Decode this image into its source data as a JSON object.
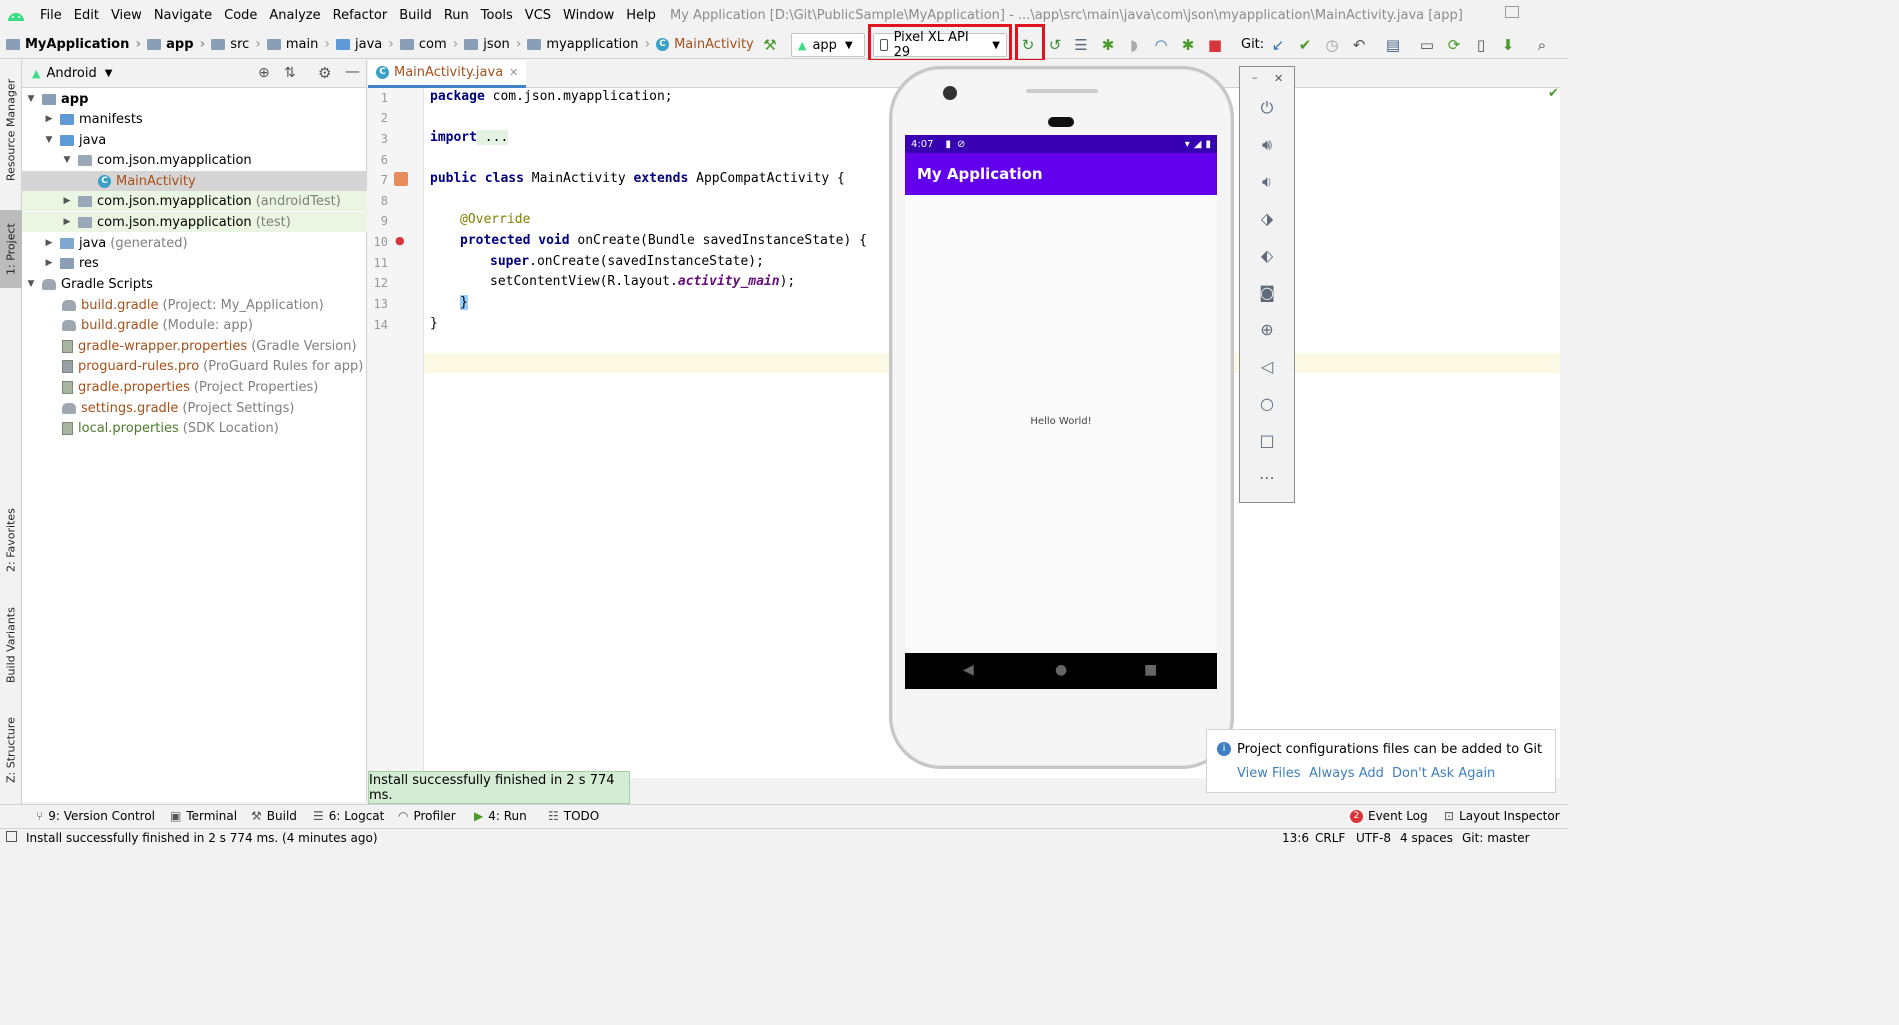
{
  "menu": {
    "items": [
      "File",
      "Edit",
      "View",
      "Navigate",
      "Code",
      "Analyze",
      "Refactor",
      "Build",
      "Run",
      "Tools",
      "VCS",
      "Window",
      "Help"
    ],
    "window_title": "My Application [D:\\Git\\PublicSample\\MyApplication] - ...\\app\\src\\main\\java\\com\\json\\myapplication\\MainActivity.java [app]"
  },
  "breadcrumb": {
    "items": [
      "MyApplication",
      "app",
      "src",
      "main",
      "java",
      "com",
      "json",
      "myapplication",
      "MainActivity"
    ]
  },
  "toolbar": {
    "run_config": "app",
    "device": "Pixel XL API 29",
    "git_label": "Git:"
  },
  "project": {
    "view_mode": "Android",
    "tree": [
      {
        "label": "app",
        "note": ""
      },
      {
        "label": "manifests",
        "note": ""
      },
      {
        "label": "java",
        "note": ""
      },
      {
        "label": "com.json.myapplication",
        "note": ""
      },
      {
        "label": "MainActivity",
        "note": ""
      },
      {
        "label": "com.json.myapplication",
        "note": "(androidTest)"
      },
      {
        "label": "com.json.myapplication",
        "note": "(test)"
      },
      {
        "label": "java",
        "note": "(generated)"
      },
      {
        "label": "res",
        "note": ""
      },
      {
        "label": "Gradle Scripts",
        "note": ""
      },
      {
        "label": "build.gradle",
        "note": "(Project: My_Application)"
      },
      {
        "label": "build.gradle",
        "note": "(Module: app)"
      },
      {
        "label": "gradle-wrapper.properties",
        "note": "(Gradle Version)"
      },
      {
        "label": "proguard-rules.pro",
        "note": "(ProGuard Rules for app)"
      },
      {
        "label": "gradle.properties",
        "note": "(Project Properties)"
      },
      {
        "label": "settings.gradle",
        "note": "(Project Settings)"
      },
      {
        "label": "local.properties",
        "note": "(SDK Location)"
      }
    ]
  },
  "side_tabs": {
    "resource_manager": "Resource Manager",
    "project": "1: Project",
    "favorites": "2: Favorites",
    "build_variants": "Build Variants",
    "structure": "Z: Structure"
  },
  "editor": {
    "tab": "MainActivity.java",
    "line_numbers": [
      "1",
      "2",
      "3",
      "6",
      "7",
      "8",
      "9",
      "10",
      "11",
      "12",
      "13",
      "14"
    ],
    "code": {
      "l1_kw": "package",
      "l1_rest": " com.json.myapplication;",
      "l3_kw": "import",
      "l3_rest": " ...",
      "l7_kw1": "public class",
      "l7_mid": " MainActivity ",
      "l7_kw2": "extends",
      "l7_rest": " AppCompatActivity {",
      "l9": "@Override",
      "l10_kw": "protected void",
      "l10_rest": " onCreate(Bundle savedInstanceState) {",
      "l11_kw": "super",
      "l11_rest": ".onCreate(savedInstanceState);",
      "l12_a": "setContentView(R.layout.",
      "l12_b": "activity_main",
      "l12_c": ");",
      "l13": "}",
      "l14": "}"
    }
  },
  "emulator": {
    "time": "4:07",
    "app_title": "My Application",
    "content": "Hello World!"
  },
  "toast": "Install successfully finished in 2 s 774 ms.",
  "git_notification": {
    "message": "Project configurations files can be added to Git",
    "actions": [
      "View Files",
      "Always Add",
      "Don't Ask Again"
    ]
  },
  "bottom_tools": {
    "version_control": "9: Version Control",
    "terminal": "Terminal",
    "build": "Build",
    "logcat": "6: Logcat",
    "profiler": "Profiler",
    "run": "4: Run",
    "todo": "TODO",
    "event_log": "Event Log",
    "event_count": "2",
    "layout_inspector": "Layout Inspector"
  },
  "status": {
    "message": "Install successfully finished in 2 s 774 ms. (4 minutes ago)",
    "position": "13:6",
    "line_sep": "CRLF",
    "encoding": "UTF-8",
    "indent": "4 spaces",
    "git_branch": "Git: master"
  },
  "colors": {
    "app_bar": "#6200ee",
    "status_bar": "#3700b3",
    "highlight_red": "#e0141e",
    "toast_bg": "#d4ecd4"
  }
}
